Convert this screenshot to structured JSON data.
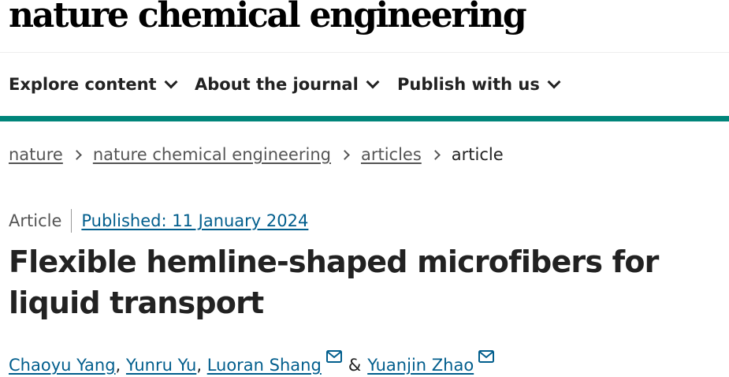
{
  "journal": {
    "title": "nature chemical engineering"
  },
  "nav": {
    "items": [
      {
        "label": "Explore content",
        "icon": "chevron-down-icon"
      },
      {
        "label": "About the journal",
        "icon": "chevron-down-icon"
      },
      {
        "label": "Publish with us",
        "icon": "chevron-down-icon"
      }
    ]
  },
  "breadcrumb": {
    "items": [
      {
        "label": "nature"
      },
      {
        "label": "nature chemical engineering"
      },
      {
        "label": "articles"
      },
      {
        "label": "article"
      }
    ]
  },
  "article": {
    "type": "Article",
    "published": "Published: 11 January 2024",
    "title": "Flexible hemline-shaped microfibers for liquid transport",
    "authors": [
      {
        "name": "Chaoyu Yang",
        "separator": ",",
        "has_email": false
      },
      {
        "name": "Yunru Yu",
        "separator": ",",
        "has_email": false
      },
      {
        "name": "Luoran Shang",
        "separator": "",
        "has_email": true
      },
      {
        "name": "Yuanjin Zhao",
        "separator": "",
        "has_email": true
      }
    ],
    "author_conjunction": "&"
  },
  "colors": {
    "accent": "#00857a",
    "link": "#025e8d",
    "text": "#222222",
    "muted": "#555555"
  }
}
